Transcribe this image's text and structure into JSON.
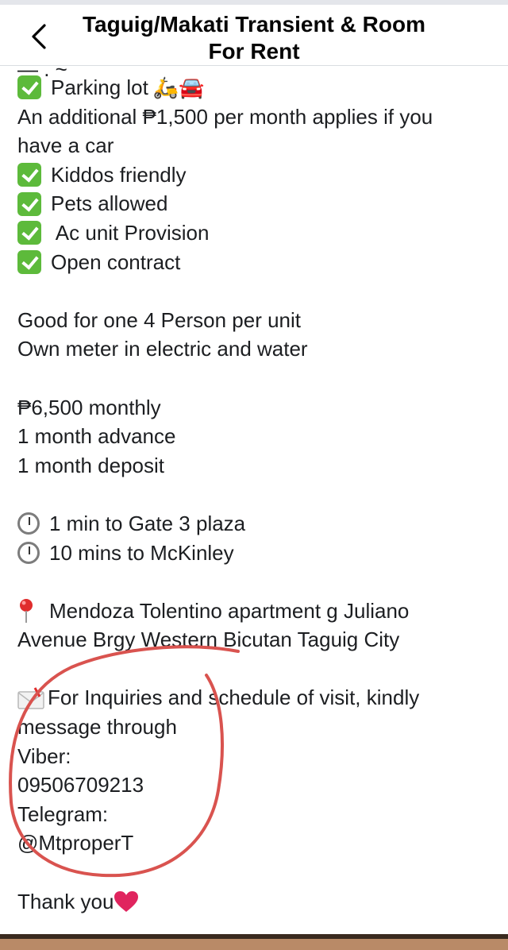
{
  "header": {
    "title": "Taguig/Makati Transient & Room For Rent"
  },
  "peek_text": "— . ~",
  "amenities": [
    {
      "label": "Parking lot",
      "extra": "🛵🚘"
    },
    {
      "label": "Kiddos friendly"
    },
    {
      "label": "Pets allowed"
    },
    {
      "label": " Ac unit Provision"
    },
    {
      "label": "Open contract"
    }
  ],
  "car_fee_note_1": "An additional ₱1,500 per month applies if you",
  "car_fee_note_2": "have a car",
  "capacity": {
    "line1": "Good for one 4 Person per unit",
    "line2": "Own meter in electric and water"
  },
  "pricing": {
    "monthly": "₱6,500 monthly",
    "advance": "1 month advance",
    "deposit": "1 month deposit"
  },
  "distances": [
    {
      "label": "1 min to Gate 3 plaza"
    },
    {
      "label": "10 mins to McKinley"
    }
  ],
  "address": {
    "line1": "Mendoza Tolentino apartment g Juliano",
    "line2": "Avenue Brgy Western Bicutan Taguig City"
  },
  "contact": {
    "intro1": "For Inquiries and schedule of visit, kindly",
    "intro2": "message through",
    "viber_label": "Viber:",
    "viber_number": "09506709213",
    "telegram_label": "Telegram:",
    "telegram_handle": "@MtproperT"
  },
  "closing": "Thank you",
  "colors": {
    "check_green": "#5dba3b",
    "annotation_red": "#d9534f",
    "heart_red": "#e0245e",
    "pin_red": "#e02d2d"
  }
}
